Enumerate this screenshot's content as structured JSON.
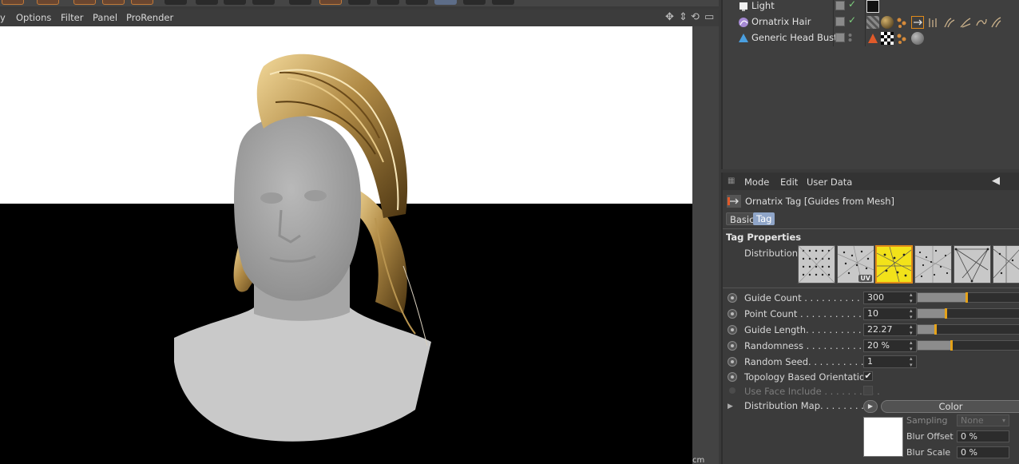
{
  "viewport": {
    "menu": [
      "y",
      "Options",
      "Filter",
      "Panel",
      "ProRender"
    ],
    "gutter_label": "cm"
  },
  "object_manager": {
    "objects": [
      {
        "name": "Light",
        "icon": "light-object-icon"
      },
      {
        "name": "Ornatrix Hair",
        "icon": "ornatrix-hair-icon"
      },
      {
        "name": "Generic Head Bust",
        "icon": "polygon-object-icon"
      }
    ]
  },
  "attribute_manager": {
    "menu": [
      "Mode",
      "Edit",
      "User Data"
    ],
    "title": "Ornatrix Tag [Guides from Mesh]",
    "tabs": [
      "Basic",
      "Tag"
    ],
    "active_tab": "Tag",
    "section": "Tag Properties",
    "distribution_label": "Distribution",
    "uv_badge": "UV",
    "properties": [
      {
        "label": "Guide Count . . . . . . . . . . . .",
        "value": "300",
        "slider": 0.48
      },
      {
        "label": "Point Count . . . . . . . . . . . .",
        "value": "10",
        "slider": 0.27
      },
      {
        "label": "Guide Length. . . . . . . . . . . .",
        "value": "22.27",
        "slider": 0.17
      },
      {
        "label": "Randomness . . . . . . . . . . . .",
        "value": "20 %",
        "slider": 0.33
      },
      {
        "label": "Random Seed. . . . . . . . . . . .",
        "value": "1"
      }
    ],
    "topology_label": "Topology Based Orientation",
    "topology_checked": "✔",
    "face_include_label": "Use Face Include . . . . . . . . . .",
    "distribution_map_label": "Distribution Map. . . . . . . . . .",
    "color_button": "Color",
    "sampling_label": "Sampling",
    "sampling_value": "None",
    "blur_offset_label": "Blur Offset",
    "blur_offset_value": "0 %",
    "blur_scale_label": "Blur Scale",
    "blur_scale_value": "0 %"
  },
  "colors": {
    "accent_orange": "#e5a219",
    "selected_thumb": "#f2e21a",
    "active_tab": "#8fa5c8"
  }
}
